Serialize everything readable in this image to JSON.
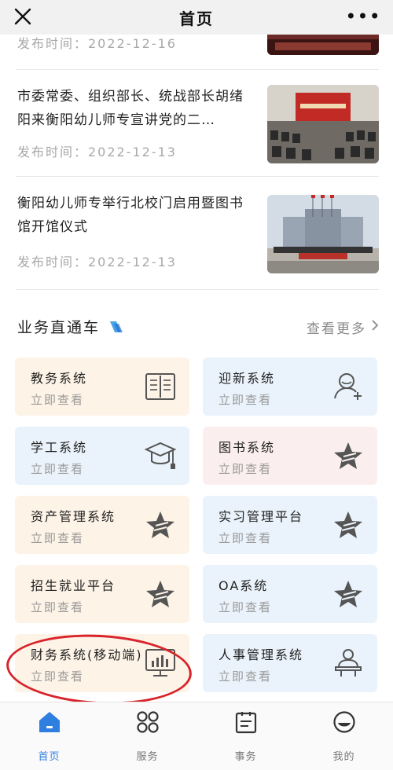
{
  "navbar": {
    "title": "首页",
    "more_label": "•••"
  },
  "news": [
    {
      "title": "",
      "date": "发布时间：2022-12-16",
      "thumb_icon": "news-photo-icon"
    },
    {
      "title": "市委常委、组织部长、统战部长胡绪阳来衡阳幼儿师专宣讲党的二…",
      "date": "发布时间：2022-12-13",
      "thumb_icon": "meeting-hall-photo-icon"
    },
    {
      "title": "衡阳幼儿师专举行北校门启用暨图书馆开馆仪式",
      "date": "发布时间：2022-12-13",
      "thumb_icon": "campus-gate-photo-icon"
    }
  ],
  "section": {
    "title": "业务直通车",
    "more": "查看更多",
    "more_icon": "chevron-right-icon"
  },
  "services": [
    {
      "title": "教务系统",
      "sub": "立即查看",
      "icon": "book-icon",
      "color": "peach"
    },
    {
      "title": "迎新系统",
      "sub": "立即查看",
      "icon": "user-add-icon",
      "color": "blue"
    },
    {
      "title": "学工系统",
      "sub": "立即查看",
      "icon": "graduation-cap-icon",
      "color": "blue"
    },
    {
      "title": "图书系统",
      "sub": "立即查看",
      "icon": "star-icon",
      "color": "pink"
    },
    {
      "title": "资产管理系统",
      "sub": "立即查看",
      "icon": "star-icon",
      "color": "peach"
    },
    {
      "title": "实习管理平台",
      "sub": "立即查看",
      "icon": "star-icon",
      "color": "blue"
    },
    {
      "title": "招生就业平台",
      "sub": "立即查看",
      "icon": "star-icon",
      "color": "peach"
    },
    {
      "title": "OA系统",
      "sub": "立即查看",
      "icon": "star-icon",
      "color": "blue"
    },
    {
      "title": "财务系统(移动端)",
      "sub": "立即查看",
      "icon": "monitor-chart-icon",
      "color": "peach"
    },
    {
      "title": "人事管理系统",
      "sub": "立即查看",
      "icon": "person-desk-icon",
      "color": "blue"
    }
  ],
  "tabbar": [
    {
      "label": "首页",
      "icon": "home-icon",
      "active": true
    },
    {
      "label": "服务",
      "icon": "grid-apps-icon",
      "active": false
    },
    {
      "label": "事务",
      "icon": "clipboard-icon",
      "active": false
    },
    {
      "label": "我的",
      "icon": "profile-icon",
      "active": false
    }
  ],
  "colors": {
    "accent": "#2f7fe0",
    "annotation": "#d8242a",
    "peach_card": "#fdf3e7",
    "blue_card": "#eaf3fb",
    "pink_card": "#fbeeee"
  }
}
